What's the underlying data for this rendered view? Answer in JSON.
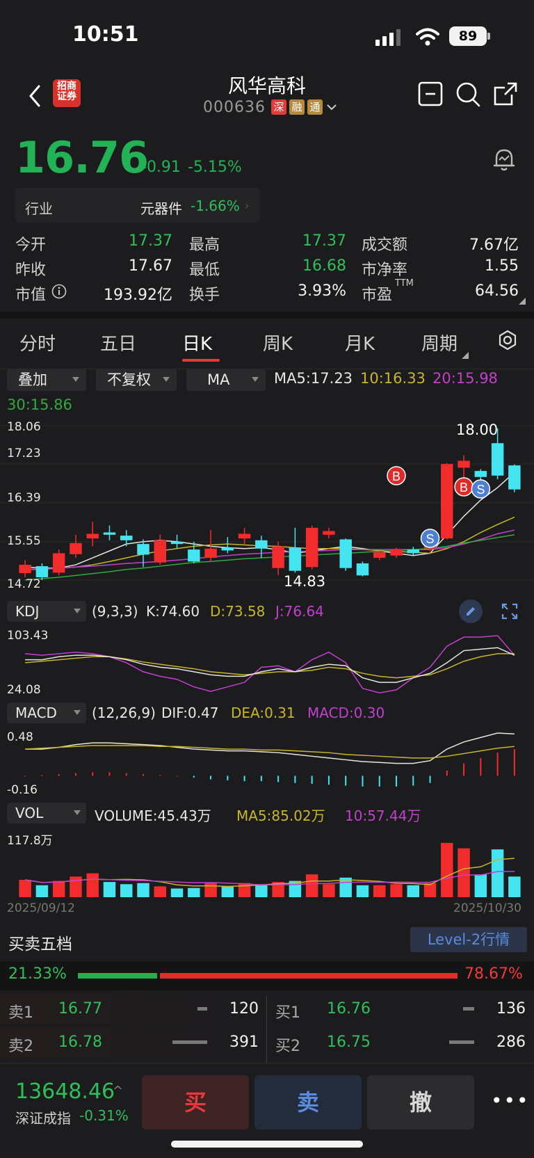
{
  "status_bar": {
    "time": "10:51",
    "battery": "89"
  },
  "header": {
    "logo_line1": "招商",
    "logo_line2": "证券",
    "stock_name": "风华高科",
    "stock_code": "000636",
    "tags": [
      "深",
      "融",
      "通"
    ]
  },
  "quote": {
    "price": "16.76",
    "change": "-0.91",
    "change_pct": "-5.15%",
    "industry_label": "行业",
    "industry_name": "元器件",
    "industry_change": "-1.66%"
  },
  "stats": {
    "open_label": "今开",
    "open": "17.37",
    "high_label": "最高",
    "high": "17.37",
    "turnover_amt_label": "成交额",
    "turnover_amt": "7.67亿",
    "prev_close_label": "昨收",
    "prev_close": "17.67",
    "low_label": "最低",
    "low": "16.68",
    "pb_label": "市净率",
    "pb": "1.55",
    "mkt_cap_label": "市值",
    "mkt_cap": "193.92亿",
    "turnover_rate_label": "换手",
    "turnover_rate": "3.93%",
    "pe_label": "市盈",
    "pe_sup": "TTM",
    "pe": "64.56"
  },
  "period_tabs": [
    "分时",
    "五日",
    "日K",
    "周K",
    "月K",
    "周期"
  ],
  "active_tab": "日K",
  "chart_controls": {
    "overlay": "叠加",
    "adjust": "不复权",
    "indicator": "MA",
    "ma5": "MA5:17.23",
    "ma10": "10:16.33",
    "ma20": "20:15.98",
    "ma30": "30:15.86"
  },
  "colors": {
    "up": "#f22c2c",
    "down": "#44e4f0",
    "ma5": "#e6e6e6",
    "ma10": "#c9b52a",
    "ma20": "#c43fd0",
    "ma30": "#34a83e"
  },
  "chart_data": {
    "type": "candlestick",
    "y_ticks": [
      "18.06",
      "17.23",
      "16.39",
      "15.55",
      "14.72"
    ],
    "high_label": "18.00",
    "low_label": "14.83",
    "markers": [
      "B",
      "B",
      "S",
      "S"
    ],
    "candles": [
      {
        "o": 14.87,
        "c": 15.05,
        "h": 15.15,
        "l": 14.78
      },
      {
        "o": 15.02,
        "c": 14.78,
        "h": 15.08,
        "l": 14.72
      },
      {
        "o": 14.88,
        "c": 15.3,
        "h": 15.38,
        "l": 14.82
      },
      {
        "o": 15.28,
        "c": 15.52,
        "h": 15.7,
        "l": 15.2
      },
      {
        "o": 15.62,
        "c": 15.72,
        "h": 15.98,
        "l": 15.45
      },
      {
        "o": 15.75,
        "c": 15.7,
        "h": 15.9,
        "l": 15.58
      },
      {
        "o": 15.68,
        "c": 15.58,
        "h": 15.8,
        "l": 15.45
      },
      {
        "o": 15.5,
        "c": 15.27,
        "h": 15.6,
        "l": 15.0
      },
      {
        "o": 15.1,
        "c": 15.58,
        "h": 15.7,
        "l": 15.05
      },
      {
        "o": 15.55,
        "c": 15.5,
        "h": 15.7,
        "l": 15.4
      },
      {
        "o": 15.38,
        "c": 15.12,
        "h": 15.55,
        "l": 15.08
      },
      {
        "o": 15.2,
        "c": 15.4,
        "h": 15.8,
        "l": 15.12
      },
      {
        "o": 15.42,
        "c": 15.36,
        "h": 15.65,
        "l": 15.3
      },
      {
        "o": 15.62,
        "c": 15.72,
        "h": 15.85,
        "l": 15.5
      },
      {
        "o": 15.58,
        "c": 15.4,
        "h": 15.68,
        "l": 15.2
      },
      {
        "o": 14.98,
        "c": 15.45,
        "h": 15.55,
        "l": 14.83
      },
      {
        "o": 15.42,
        "c": 14.92,
        "h": 15.85,
        "l": 14.88
      },
      {
        "o": 15.0,
        "c": 15.85,
        "h": 15.9,
        "l": 14.95
      },
      {
        "o": 15.7,
        "c": 15.78,
        "h": 15.85,
        "l": 15.62
      },
      {
        "o": 15.6,
        "c": 14.98,
        "h": 15.62,
        "l": 14.92
      },
      {
        "o": 15.08,
        "c": 14.82,
        "h": 15.12,
        "l": 14.8
      },
      {
        "o": 15.2,
        "c": 15.32,
        "h": 15.35,
        "l": 15.15
      },
      {
        "o": 15.25,
        "c": 15.38,
        "h": 15.42,
        "l": 15.2
      },
      {
        "o": 15.38,
        "c": 15.3,
        "h": 15.44,
        "l": 15.26
      },
      {
        "o": 15.4,
        "c": 15.58,
        "h": 15.62,
        "l": 15.35
      },
      {
        "o": 15.62,
        "c": 17.23,
        "h": 17.25,
        "l": 15.6
      },
      {
        "o": 17.15,
        "c": 17.3,
        "h": 17.42,
        "l": 16.9
      },
      {
        "o": 17.08,
        "c": 16.95,
        "h": 17.12,
        "l": 16.7
      },
      {
        "o": 17.68,
        "c": 16.98,
        "h": 18.0,
        "l": 16.9
      },
      {
        "o": 17.2,
        "c": 16.68,
        "h": 17.22,
        "l": 16.62
      }
    ],
    "ma5": [
      15.0,
      14.98,
      14.98,
      15.05,
      15.2,
      15.35,
      15.5,
      15.55,
      15.58,
      15.55,
      15.5,
      15.45,
      15.42,
      15.4,
      15.42,
      15.38,
      15.3,
      15.35,
      15.4,
      15.45,
      15.4,
      15.35,
      15.3,
      15.25,
      15.3,
      15.7,
      16.1,
      16.45,
      16.72,
      17.05
    ],
    "ma10": [
      14.95,
      14.95,
      14.98,
      15.0,
      15.05,
      15.12,
      15.2,
      15.28,
      15.35,
      15.4,
      15.45,
      15.48,
      15.5,
      15.48,
      15.46,
      15.45,
      15.42,
      15.4,
      15.4,
      15.4,
      15.38,
      15.36,
      15.34,
      15.32,
      15.3,
      15.4,
      15.55,
      15.75,
      15.92,
      16.08
    ],
    "ma20": [
      14.95,
      14.96,
      14.98,
      15.0,
      15.02,
      15.05,
      15.08,
      15.1,
      15.12,
      15.15,
      15.18,
      15.22,
      15.25,
      15.28,
      15.3,
      15.32,
      15.33,
      15.35,
      15.36,
      15.38,
      15.38,
      15.38,
      15.38,
      15.38,
      15.38,
      15.42,
      15.5,
      15.6,
      15.72,
      15.8
    ],
    "ma30": [
      14.72,
      14.75,
      14.78,
      14.82,
      14.86,
      14.9,
      14.95,
      14.98,
      15.02,
      15.06,
      15.1,
      15.12,
      15.15,
      15.18,
      15.2,
      15.22,
      15.24,
      15.26,
      15.28,
      15.3,
      15.32,
      15.34,
      15.36,
      15.38,
      15.4,
      15.45,
      15.52,
      15.58,
      15.64,
      15.7
    ]
  },
  "kdj": {
    "selector": "KDJ",
    "params": "(9,3,3)",
    "k": "K:74.60",
    "d": "D:73.58",
    "j": "J:76.64",
    "top": "103.43",
    "bottom": "24.08"
  },
  "macd": {
    "selector": "MACD",
    "params": "(12,26,9)",
    "dif": "DIF:0.47",
    "dea": "DEA:0.31",
    "macd": "MACD:0.30",
    "top": "0.48",
    "bottom": "-0.16"
  },
  "vol": {
    "selector": "VOL",
    "volume": "VOLUME:45.43万",
    "ma5": "MA5:85.02万",
    "ma10": "10:57.44万",
    "top": "117.8万"
  },
  "dates": {
    "start": "2025/09/12",
    "end": "2025/10/30"
  },
  "orderbook": {
    "title": "买卖五档",
    "level2": "Level-2行情",
    "buy_ratio": "21.33%",
    "sell_ratio": "78.67%",
    "asks": [
      {
        "label": "卖1",
        "price": "16.77",
        "vol": "120"
      },
      {
        "label": "卖2",
        "price": "16.78",
        "vol": "391"
      }
    ],
    "bids": [
      {
        "label": "买1",
        "price": "16.76",
        "vol": "136"
      },
      {
        "label": "买2",
        "price": "16.75",
        "vol": "286"
      }
    ]
  },
  "bottom": {
    "index_value": "13648.46",
    "index_name": "深证成指",
    "index_change": "-0.31%",
    "buy": "买",
    "sell": "卖",
    "cancel": "撤",
    "more": "•••"
  }
}
